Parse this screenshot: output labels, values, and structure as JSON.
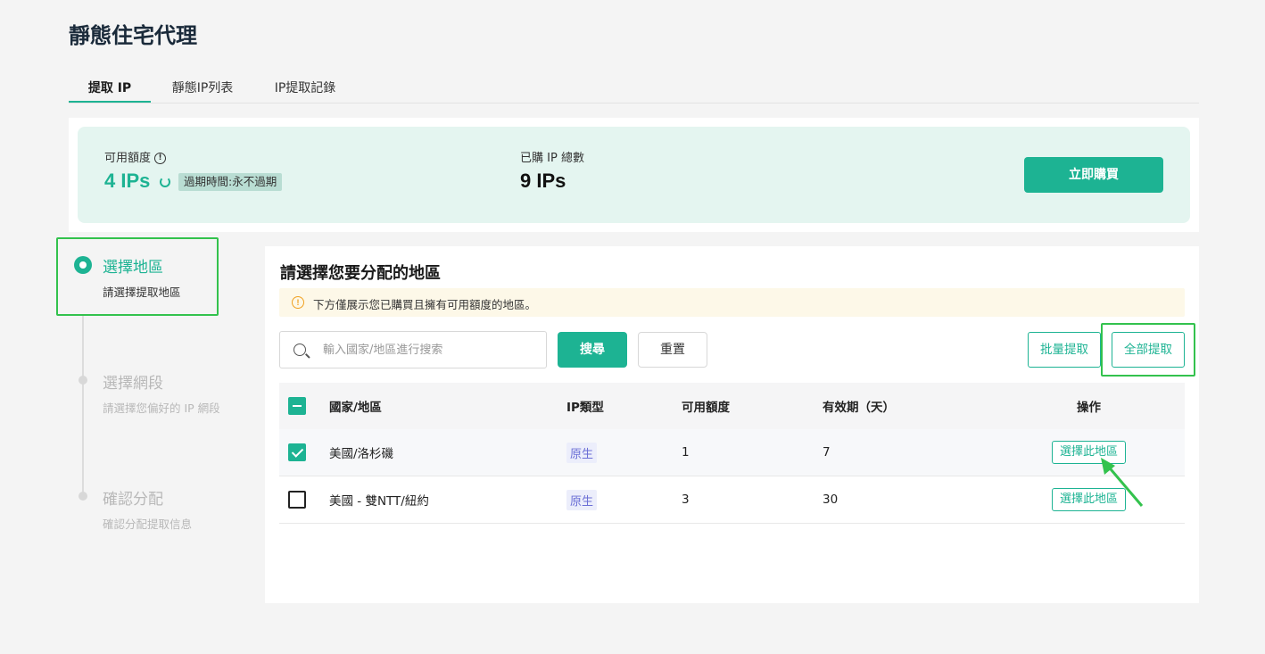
{
  "header": {
    "title": "靜態住宅代理"
  },
  "tabs": [
    {
      "label": "提取 IP",
      "active": true
    },
    {
      "label": "靜態IP列表",
      "active": false
    },
    {
      "label": "IP提取記錄",
      "active": false
    }
  ],
  "quota": {
    "available_label": "可用額度",
    "available_value": "4 IPs",
    "expire_badge": "過期時間:永不過期",
    "purchased_label": "已購 IP 總數",
    "purchased_value": "9 IPs",
    "buy_button": "立即購買"
  },
  "steps": [
    {
      "title": "選擇地區",
      "subtitle": "請選擇提取地區",
      "active": true
    },
    {
      "title": "選擇網段",
      "subtitle": "請選擇您偏好的 IP 網段",
      "active": false
    },
    {
      "title": "確認分配",
      "subtitle": "確認分配提取信息",
      "active": false
    }
  ],
  "panel": {
    "title": "請選擇您要分配的地區",
    "notice": "下方僅展示您已購買且擁有可用額度的地區。",
    "search_placeholder": "輸入國家/地區進行搜索",
    "search_button": "搜尋",
    "reset_button": "重置",
    "batch_button": "批量提取",
    "all_button": "全部提取"
  },
  "table": {
    "headers": {
      "country": "國家/地區",
      "type": "IP類型",
      "quota": "可用額度",
      "valid": "有效期（天）",
      "op": "操作"
    },
    "rows": [
      {
        "checked": true,
        "country": "美國/洛杉磯",
        "type": "原生",
        "quota": "1",
        "valid": "7",
        "action": "選擇此地區"
      },
      {
        "checked": false,
        "country": "美國 - 雙NTT/紐約",
        "type": "原生",
        "quota": "3",
        "valid": "30",
        "action": "選擇此地區"
      }
    ]
  },
  "colors": {
    "accent": "#1db393",
    "highlight": "#33c24d",
    "notice_bg": "#fdf8e8"
  }
}
